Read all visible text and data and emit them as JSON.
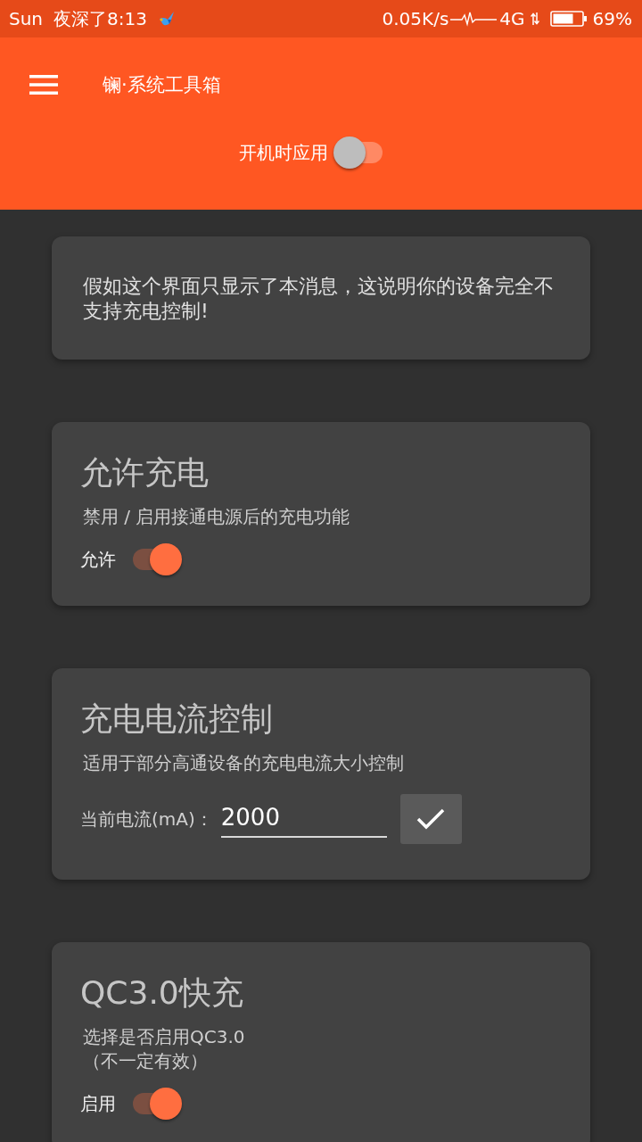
{
  "status_bar": {
    "carrier": "Sun",
    "time": "夜深了8:13",
    "network_speed": "0.05K/s",
    "network_type": "4G",
    "battery": "69%"
  },
  "app_bar": {
    "title": "镧·系统工具箱",
    "boot_apply": {
      "label": "开机时应用",
      "on": false
    }
  },
  "cards": [
    {
      "kind": "notice",
      "text": "假如这个界面只显示了本消息，这说明你的设备完全不支持充电控制!"
    },
    {
      "kind": "switch",
      "title": "允许充电",
      "description": "禁用 / 启用接通电源后的充电功能",
      "label": "允许",
      "on": true
    },
    {
      "kind": "input",
      "title": "充电电流控制",
      "description": "适用于部分高通设备的充电电流大小控制",
      "label": "当前电流(mA)：",
      "value": "2000"
    },
    {
      "kind": "switch",
      "title": "QC3.0快充",
      "description": "选择是否启用QC3.0\n（不一定有效）",
      "label": "启用",
      "on": true
    }
  ]
}
